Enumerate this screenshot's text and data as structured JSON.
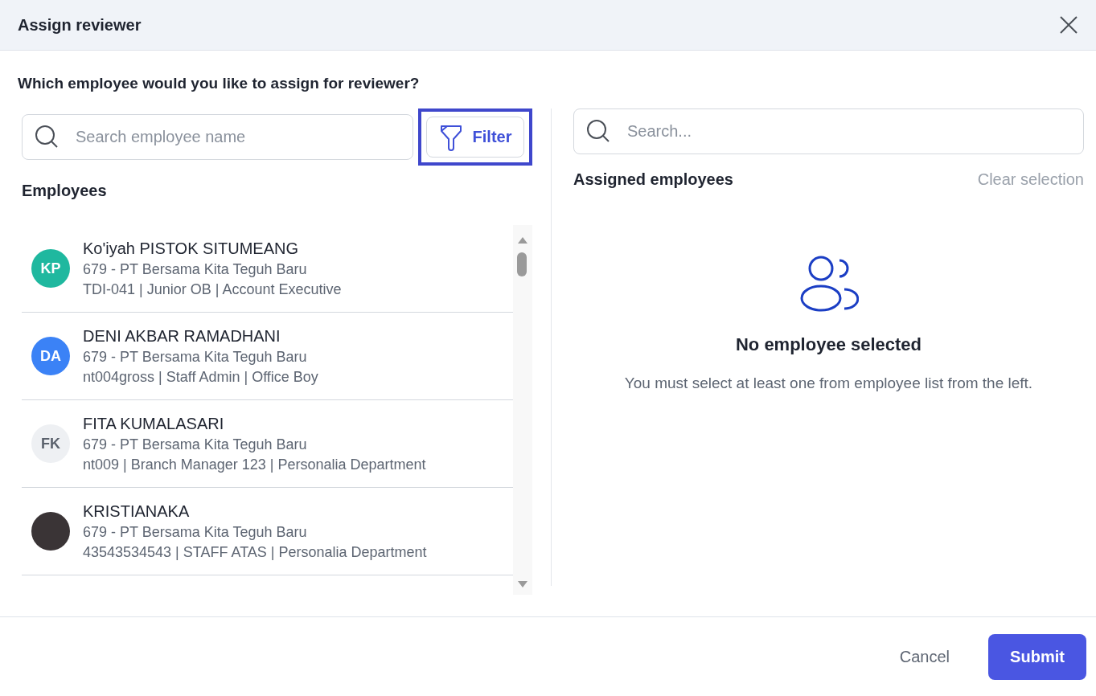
{
  "dialog": {
    "title": "Assign reviewer",
    "question": "Which employee would you like to assign for reviewer?"
  },
  "left": {
    "search": {
      "placeholder": "Search employee name"
    },
    "filter": {
      "label": "Filter",
      "focused": true
    },
    "heading": "Employees",
    "employees": [
      {
        "name": "Ko'iyah PISTOK SITUMEANG",
        "company": "679 - PT Bersama Kita Teguh Baru",
        "details": "TDI-041 | Junior OB | Account Executive",
        "avatar": {
          "kind": "initials",
          "initials": "KP",
          "color": "#1fb89f"
        }
      },
      {
        "name": "DENI AKBAR RAMADHANI",
        "company": "679 - PT Bersama Kita Teguh Baru",
        "details": "nt004gross | Staff Admin | Office Boy",
        "avatar": {
          "kind": "initials",
          "initials": "DA",
          "color": "#3b82f6"
        }
      },
      {
        "name": "FITA KUMALASARI",
        "company": "679 - PT Bersama Kita Teguh Baru",
        "details": "nt009 | Branch Manager 123 | Personalia Department",
        "avatar": {
          "kind": "initials",
          "initials": "FK",
          "color": "#eef0f3"
        }
      },
      {
        "name": "KRISTIANAKA",
        "company": "679 - PT Bersama Kita Teguh Baru",
        "details": "43543534543 | STAFF ATAS | Personalia Department",
        "avatar": {
          "kind": "photo"
        }
      }
    ]
  },
  "right": {
    "search": {
      "placeholder": "Search..."
    },
    "heading": "Assigned employees",
    "clear": "Clear selection",
    "empty_title": "No employee selected",
    "empty_text": "You must select at least one from employee list from the left."
  },
  "footer": {
    "cancel": "Cancel",
    "submit": "Submit"
  }
}
